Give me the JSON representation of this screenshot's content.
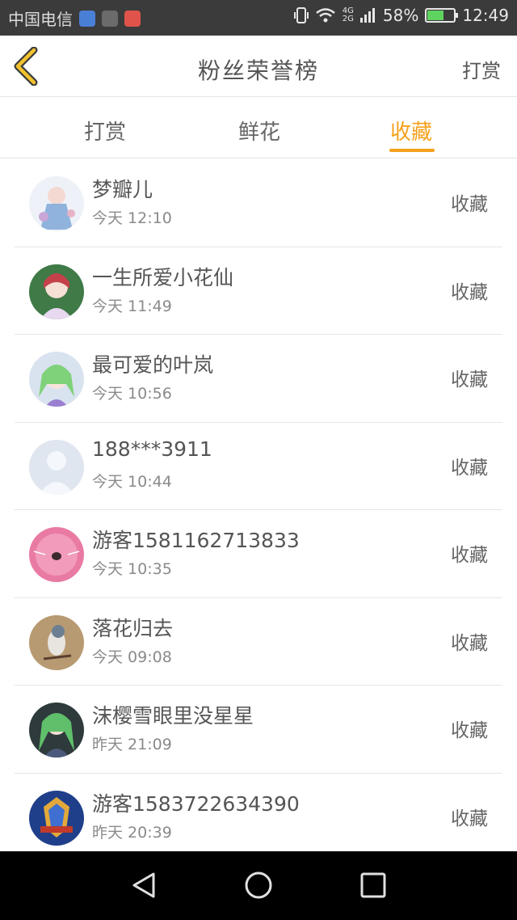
{
  "status_bar": {
    "carrier": "中国电信",
    "network": "4G",
    "network2": "2G",
    "battery": "58%",
    "battery_level": 0.58,
    "time": "12:49"
  },
  "header": {
    "title": "粉丝荣誉榜",
    "action": "打赏"
  },
  "tabs": [
    {
      "label": "打赏",
      "active": false
    },
    {
      "label": "鲜花",
      "active": false
    },
    {
      "label": "收藏",
      "active": true
    }
  ],
  "accent_color": "#f5a11c",
  "rows": [
    {
      "name": "梦瓣儿",
      "time": "今天 12:10",
      "action": "收藏"
    },
    {
      "name": "一生所爱小花仙",
      "time": "今天 11:49",
      "action": "收藏"
    },
    {
      "name": "最可爱的叶岚",
      "time": "今天 10:56",
      "action": "收藏"
    },
    {
      "name": "188***3911",
      "time": "今天 10:44",
      "action": "收藏"
    },
    {
      "name": "游客1581162713833",
      "time": "今天 10:35",
      "action": "收藏"
    },
    {
      "name": "落花归去",
      "time": "今天 09:08",
      "action": "收藏"
    },
    {
      "name": "沫樱雪眼里没星星",
      "time": "昨天 21:09",
      "action": "收藏"
    },
    {
      "name": "游客1583722634390",
      "time": "昨天 20:39",
      "action": "收藏"
    }
  ]
}
